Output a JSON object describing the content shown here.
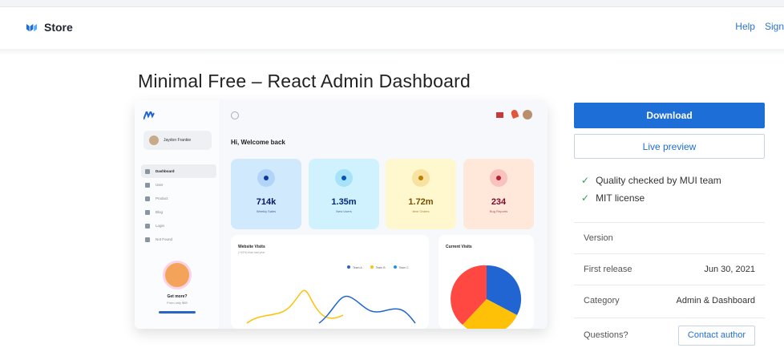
{
  "header": {
    "brand_name": "Store",
    "links": [
      "Help",
      "Sign"
    ]
  },
  "page_title": "Minimal Free – React Admin Dashboard",
  "preview": {
    "username": "Jaydon Frankie",
    "nav": [
      "Dashboard",
      "User",
      "Product",
      "Blog",
      "Login",
      "Not Found"
    ],
    "promo_title": "Get more?",
    "promo_sub": "From only $69",
    "welcome": "Hi, Welcome back",
    "stats": [
      {
        "value": "714k",
        "label": "Weekly Sales",
        "bg": "#d1e9fc",
        "fg": "#061b64",
        "icon_bg": "#b1d4f8",
        "dot": "#103996"
      },
      {
        "value": "1.35m",
        "label": "New Users",
        "bg": "#d0f2ff",
        "fg": "#04297a",
        "icon_bg": "#a6e3f8",
        "dot": "#0c53b7"
      },
      {
        "value": "1.72m",
        "label": "Item Orders",
        "bg": "#fff7cd",
        "fg": "#7a4f01",
        "icon_bg": "#f7e2a0",
        "dot": "#b78103"
      },
      {
        "value": "234",
        "label": "Bug Reports",
        "bg": "#ffe7d9",
        "fg": "#7a0c2e",
        "icon_bg": "#f8c3bd",
        "dot": "#b72136"
      }
    ],
    "chart1_title": "Website Visits",
    "chart1_sub": "(+43%) than last year",
    "legend": [
      {
        "name": "Team A",
        "color": "#2065d1"
      },
      {
        "name": "Team B",
        "color": "#ffc107"
      },
      {
        "name": "Team C",
        "color": "#1890ff"
      }
    ],
    "chart2_title": "Current Visits"
  },
  "actions": {
    "download": "Download",
    "live_preview": "Live preview"
  },
  "features": [
    "Quality checked by MUI team",
    "MIT license"
  ],
  "info": {
    "version_label": "Version",
    "version_value": "",
    "first_release_label": "First release",
    "first_release_value": "Jun 30, 2021",
    "category_label": "Category",
    "category_value": "Admin & Dashboard",
    "questions_label": "Questions?",
    "contact_button": "Contact author"
  },
  "colors": {
    "primary": "#1e6ed8",
    "check": "#2e9c5a"
  }
}
